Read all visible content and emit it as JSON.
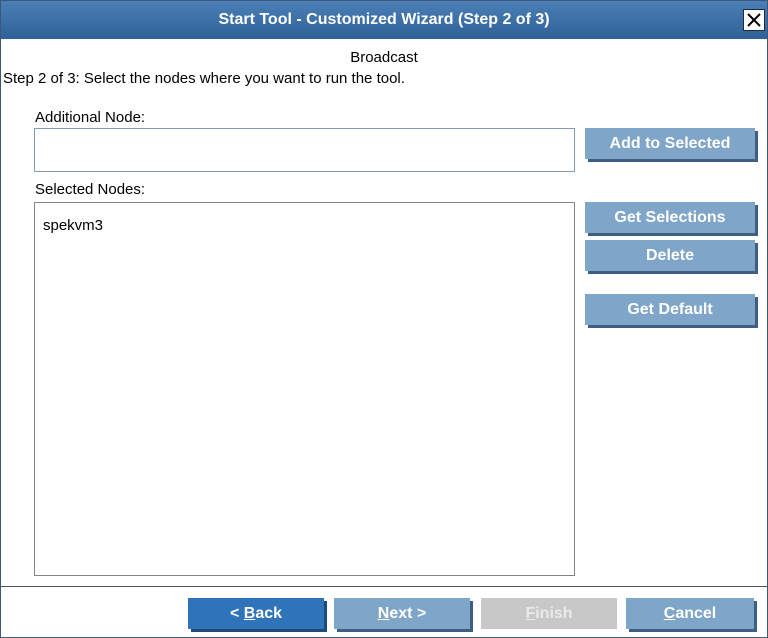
{
  "window": {
    "title": "Start Tool - Customized Wizard (Step 2 of 3)"
  },
  "subtitle": "Broadcast",
  "instructions": "Step 2 of 3: Select the nodes where you want to run the tool.",
  "additional_node": {
    "label": "Additional Node:",
    "value": ""
  },
  "selected_nodes": {
    "label": "Selected Nodes:",
    "items": [
      "spekvm3"
    ]
  },
  "buttons": {
    "add_to_selected": "Add to Selected",
    "get_selections": "Get Selections",
    "delete": "Delete",
    "get_default": "Get Default"
  },
  "footer": {
    "back": {
      "prefix": "< ",
      "mnemonic": "B",
      "rest": "ack"
    },
    "next": {
      "mnemonic": "N",
      "rest": "ext >"
    },
    "finish": {
      "mnemonic": "F",
      "rest": "inish"
    },
    "cancel": {
      "mnemonic": "C",
      "rest": "ancel"
    }
  },
  "colors": {
    "titlebar": "#3a6ea5",
    "button_primary": "#2f73b8",
    "button_normal": "#7fa5c9",
    "button_disabled": "#c8c8c8"
  },
  "icons": {
    "close": "close-icon"
  }
}
